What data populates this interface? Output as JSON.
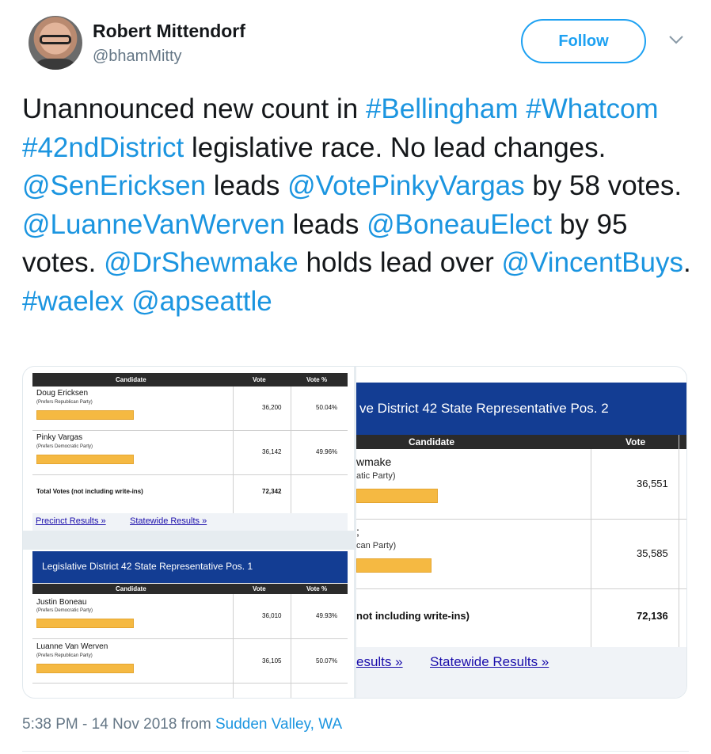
{
  "author": {
    "name": "Robert Mittendorf",
    "handle": "@bhamMitty",
    "follow_label": "Follow"
  },
  "tweet": {
    "segments": [
      {
        "text": "Unannounced new count in ",
        "type": "text"
      },
      {
        "text": "#Bellingham",
        "type": "link"
      },
      {
        "text": " ",
        "type": "text"
      },
      {
        "text": "#Whatcom",
        "type": "link"
      },
      {
        "text": "  ",
        "type": "text"
      },
      {
        "text": "#42ndDistrict",
        "type": "link"
      },
      {
        "text": " legislative race. No lead changes. ",
        "type": "text"
      },
      {
        "text": "@SenEricksen",
        "type": "link"
      },
      {
        "text": " leads ",
        "type": "text"
      },
      {
        "text": "@VotePinkyVargas",
        "type": "link"
      },
      {
        "text": " by 58 votes. ",
        "type": "text"
      },
      {
        "text": "@LuanneVanWerven",
        "type": "link"
      },
      {
        "text": " leads ",
        "type": "text"
      },
      {
        "text": "@BoneauElect",
        "type": "link"
      },
      {
        "text": " by 95 votes. ",
        "type": "text"
      },
      {
        "text": "@DrShewmake",
        "type": "link"
      },
      {
        "text": " holds lead over ",
        "type": "text"
      },
      {
        "text": "@VincentBuys",
        "type": "link"
      },
      {
        "text": ". ",
        "type": "text"
      },
      {
        "text": "#waelex",
        "type": "link"
      },
      {
        "text": " ",
        "type": "text"
      },
      {
        "text": "@apseattle",
        "type": "link"
      }
    ]
  },
  "left_table_top": {
    "headers": [
      "Candidate",
      "Vote",
      "Vote %"
    ],
    "rows": [
      {
        "name": "Doug Ericksen",
        "party": "(Prefers Republican Party)",
        "vote": "36,200",
        "pct": "50.04%"
      },
      {
        "name": "Pinky Vargas",
        "party": "(Prefers Democratic Party)",
        "vote": "36,142",
        "pct": "49.96%"
      }
    ],
    "total_label": "Total Votes (not including write-ins)",
    "total": "72,342",
    "links": [
      "Precinct Results »",
      "Statewide Results »"
    ]
  },
  "left_table_bottom": {
    "title": "Legislative District 42 State Representative Pos. 1",
    "headers": [
      "Candidate",
      "Vote",
      "Vote %"
    ],
    "rows": [
      {
        "name": "Justin Boneau",
        "party": "(Prefers Democratic Party)",
        "vote": "36,010",
        "pct": "49.93%"
      },
      {
        "name": "Luanne Van Werven",
        "party": "(Prefers Republican Party)",
        "vote": "36,105",
        "pct": "50.07%"
      }
    ]
  },
  "right_table": {
    "title": "ve District 42 State Representative Pos. 2",
    "headers": [
      "Candidate",
      "Vote"
    ],
    "rows": [
      {
        "name": "wmake",
        "party": "atic Party)",
        "vote": "36,551"
      },
      {
        "name": ";",
        "party": "can Party)",
        "vote": "35,585"
      }
    ],
    "total_label": "not including write-ins)",
    "total": "72,136",
    "links": [
      "esults »",
      "Statewide Results »"
    ]
  },
  "meta": {
    "time": "5:38 PM - 14 Nov 2018 from ",
    "source": "Sudden Valley, WA"
  },
  "colors": {
    "link": "#1b95e0",
    "follow": "#1da1f2",
    "table_header_blue": "#133d93",
    "bar": "#f5b942"
  }
}
